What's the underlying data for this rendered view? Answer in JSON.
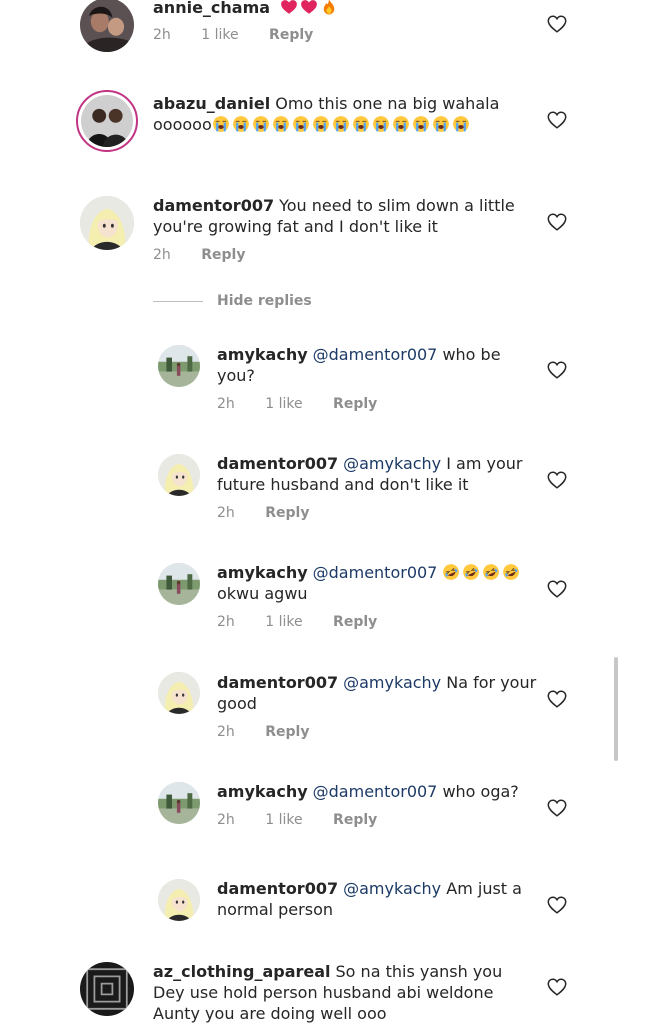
{
  "comments": [
    {
      "user": "annie_chama",
      "text": "",
      "time": "2h",
      "likes": "1 like",
      "reply": "Reply"
    },
    {
      "user": "abazu_daniel",
      "text": "Omo this one na big wahala oooooo"
    },
    {
      "user": "damentor007",
      "text": "You need to slim down  a little you're  growing fat and I don't like it",
      "time": "2h",
      "reply": "Reply"
    },
    {
      "user": "amykachy",
      "mention": "@damentor007",
      "text": "who be you?",
      "time": "2h",
      "likes": "1 like",
      "reply": "Reply"
    },
    {
      "user": "damentor007",
      "mention": "@amykachy",
      "text": "I am your future husband and don't like it",
      "time": "2h",
      "reply": "Reply"
    },
    {
      "user": "amykachy",
      "mention": "@damentor007",
      "text": "okwu agwu",
      "time": "2h",
      "likes": "1 like",
      "reply": "Reply"
    },
    {
      "user": "damentor007",
      "mention": "@amykachy",
      "text": "Na for your good",
      "time": "2h",
      "reply": "Reply"
    },
    {
      "user": "amykachy",
      "mention": "@damentor007",
      "text": "who oga?",
      "time": "2h",
      "likes": "1 like",
      "reply": "Reply"
    },
    {
      "user": "damentor007",
      "mention": "@amykachy",
      "text": "Am just a normal person"
    },
    {
      "user": "az_clothing_apareal",
      "text": "So na this yansh you Dey use hold person husband abi weldone Aunty you are doing well ooo"
    }
  ],
  "hide_replies": "Hide replies",
  "icons": {
    "like": "heart-outline-icon",
    "heart_emoji": "red-heart-emoji",
    "fire_emoji": "fire-emoji",
    "cry_emoji": "loudly-crying-emoji",
    "laugh_emoji": "rofl-emoji"
  }
}
